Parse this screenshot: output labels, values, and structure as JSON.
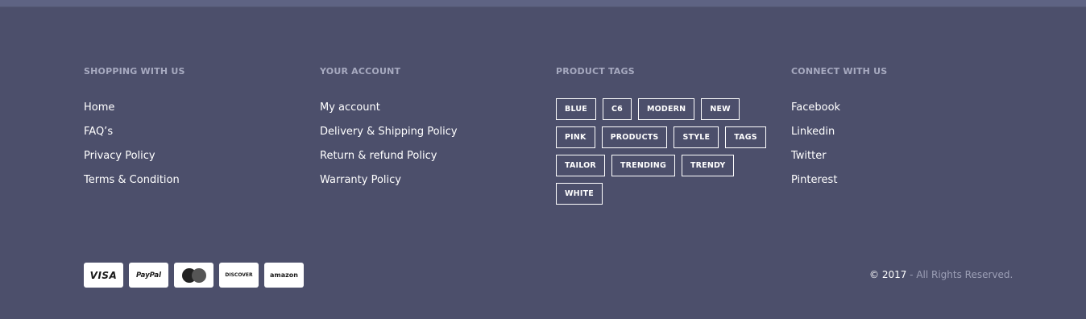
{
  "columns": [
    {
      "title": "SHOPPING WITH US",
      "links": [
        "Home",
        "FAQ’s",
        "Privacy Policy",
        "Terms & Condition"
      ]
    },
    {
      "title": "YOUR ACCOUNT",
      "links": [
        "My account",
        "Delivery & Shipping Policy",
        "Return & refund Policy",
        "Warranty Policy"
      ]
    },
    {
      "title": "PRODUCT TAGS",
      "tag_rows": [
        [
          "BLUE",
          "C6",
          "MODERN",
          "NEW"
        ],
        [
          "PINK",
          "PRODUCTS",
          "STYLE",
          "TAGS"
        ],
        [
          "TAILOR",
          "TRENDING",
          "TRENDY"
        ],
        [
          "WHITE"
        ]
      ]
    },
    {
      "title": "CONNECT WITH US",
      "links": [
        "Facebook",
        "Linkedin",
        "Twitter",
        "Pinterest"
      ]
    }
  ],
  "payments": [
    {
      "icon": "visa-icon",
      "label": "VISA"
    },
    {
      "icon": "paypal-icon",
      "label": "PayPal"
    },
    {
      "icon": "mastercard-icon",
      "label": ""
    },
    {
      "icon": "discover-icon",
      "label": "DISCOVER"
    },
    {
      "icon": "amazon-icon",
      "label": "amazon"
    }
  ],
  "copyright": {
    "symbol_year": "© 2017",
    "rest": " - All Rights Reserved."
  },
  "colors": {
    "background": "#4c4f6b",
    "heading": "#a7aac0",
    "link": "#ffffff",
    "muted": "#9c9fb6"
  }
}
